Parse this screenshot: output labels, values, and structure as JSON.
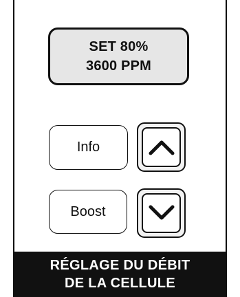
{
  "display": {
    "line1": "SET 80%",
    "line2": "3600 PPM"
  },
  "buttons": {
    "info_label": "Info",
    "boost_label": "Boost",
    "up_icon": "chevron-up-icon",
    "down_icon": "chevron-down-icon"
  },
  "footer": {
    "line1": "RÉGLAGE DU DÉBIT",
    "line2": "DE LA CELLULE"
  },
  "colors": {
    "outline": "#111111",
    "display_bg": "#e6e6e6",
    "footer_bg": "#111111",
    "footer_text": "#ffffff"
  }
}
